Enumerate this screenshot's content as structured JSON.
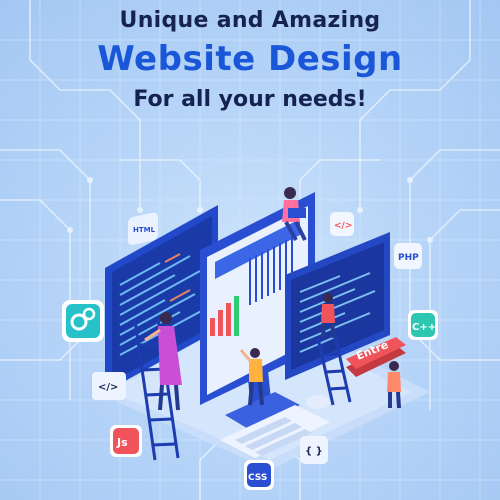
{
  "hero": {
    "line1": "Unique and Amazing",
    "line2": "Website Design",
    "line3": "For all your needs!"
  },
  "badges": {
    "html": "HTML",
    "code": "</>",
    "php": "PHP",
    "cpp": "C++",
    "js": "Js",
    "css": "CSS",
    "code_left": "</>",
    "brackets": "{ }",
    "enter": "Entre"
  },
  "colors": {
    "title_dark": "#16224f",
    "title_blue": "#1a56d8",
    "background": "#b7d5f8",
    "accent_red": "#f0545a"
  },
  "icons": [
    "gear-icon",
    "code-icon",
    "html-icon",
    "php-icon",
    "cpp-icon",
    "js-icon",
    "css-icon",
    "brackets-icon"
  ]
}
